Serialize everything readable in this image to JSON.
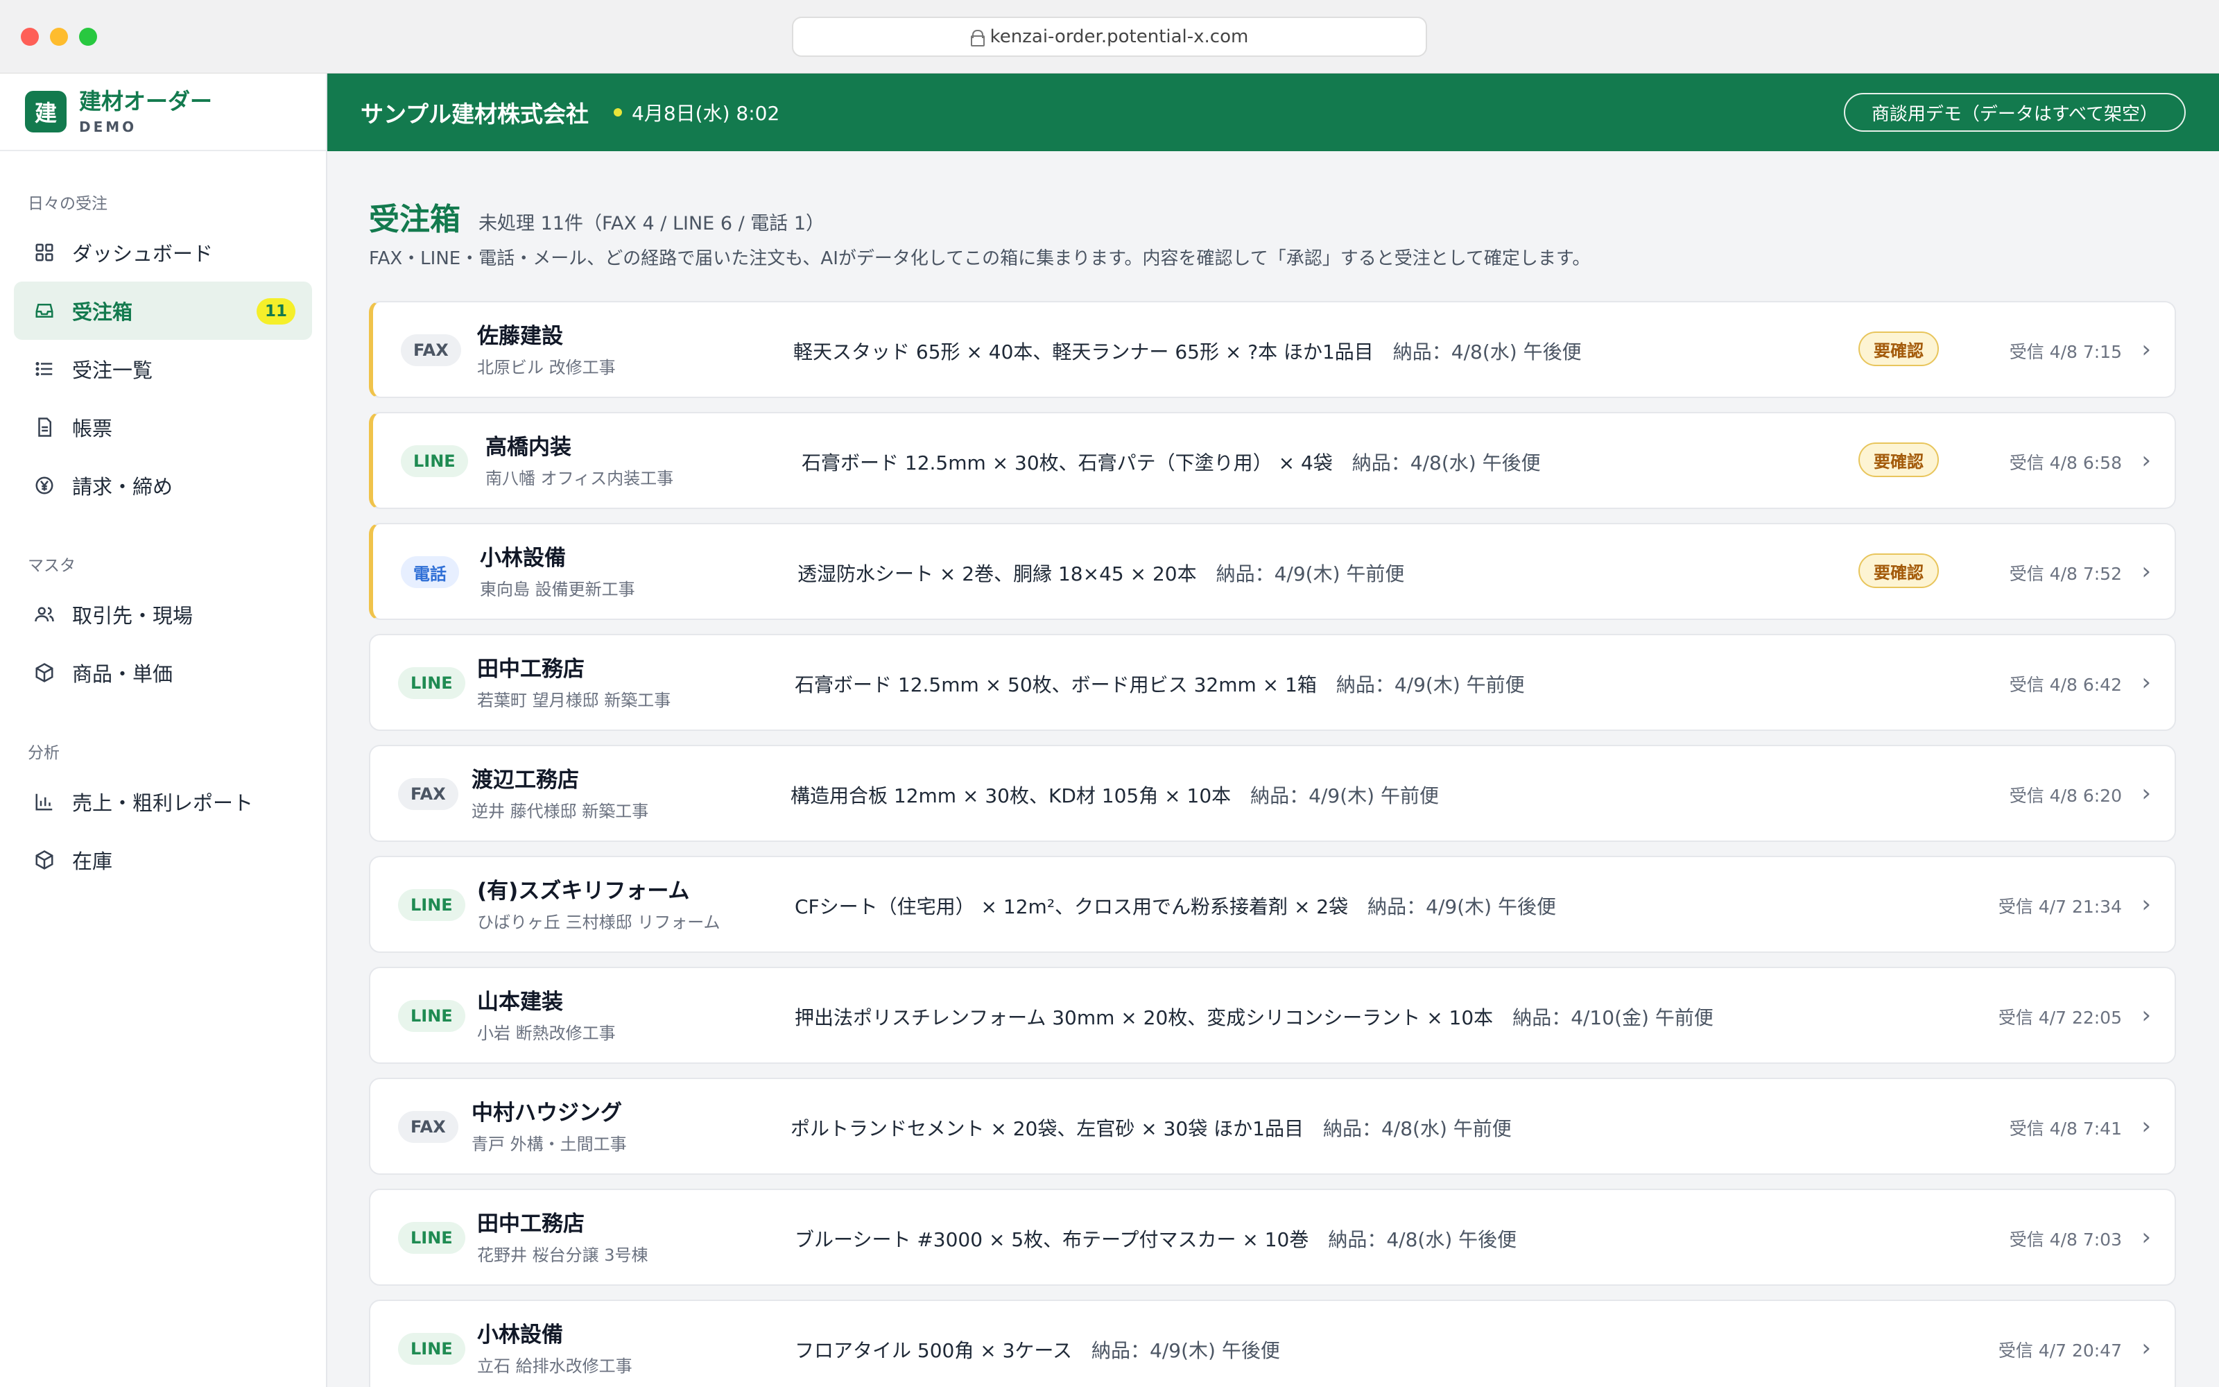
{
  "browser": {
    "url": "kenzai-order.potential-x.com"
  },
  "brand": {
    "logo_char": "建",
    "name": "建材オーダー",
    "sub": "DEMO"
  },
  "sidebar": {
    "sections": [
      {
        "title": "日々の受注",
        "items": [
          {
            "label": "ダッシュボード",
            "icon": "grid-icon"
          },
          {
            "label": "受注箱",
            "icon": "inbox-icon",
            "badge": "11",
            "active": true
          },
          {
            "label": "受注一覧",
            "icon": "list-icon"
          },
          {
            "label": "帳票",
            "icon": "document-icon"
          },
          {
            "label": "請求・締め",
            "icon": "yen-icon"
          }
        ]
      },
      {
        "title": "マスタ",
        "items": [
          {
            "label": "取引先・現場",
            "icon": "users-icon"
          },
          {
            "label": "商品・単価",
            "icon": "box-icon"
          }
        ]
      },
      {
        "title": "分析",
        "items": [
          {
            "label": "売上・粗利レポート",
            "icon": "chart-icon"
          },
          {
            "label": "在庫",
            "icon": "box-icon"
          }
        ]
      }
    ]
  },
  "header": {
    "company": "サンプル建材株式会社",
    "datetime": "4月8日(水) 8:02",
    "demo_label": "商談用デモ（データはすべて架空）"
  },
  "main": {
    "title": "受注箱",
    "summary": "未処理 11件（FAX 4 / LINE 6 / 電話 1）",
    "description": "FAX・LINE・電話・メール、どの経路で届いた注文も、AIがデータ化してこの箱に集まります。内容を確認して「承認」すると受注として確定します。",
    "orders": [
      {
        "channel": "FAX",
        "channel_class": "FAX",
        "customer": "佐藤建設",
        "site": "北原ビル 改修工事",
        "items": "軽天スタッド 65形 × 40本、軽天ランナー 65形 × ?本 ほか1品目",
        "delivery": "納品：4/8(水) 午後便",
        "status": "要確認",
        "received": "受信 4/8 7:15"
      },
      {
        "channel": "LINE",
        "channel_class": "LINE",
        "customer": "高橋内装",
        "site": "南八幡 オフィス内装工事",
        "items": "石膏ボード 12.5mm × 30枚、石膏パテ（下塗り用） × 4袋",
        "delivery": "納品：4/8(水) 午後便",
        "status": "要確認",
        "received": "受信 4/8 6:58"
      },
      {
        "channel": "電話",
        "channel_class": "TEL",
        "customer": "小林設備",
        "site": "東向島 設備更新工事",
        "items": "透湿防水シート × 2巻、胴縁 18×45 × 20本",
        "delivery": "納品：4/9(木) 午前便",
        "status": "要確認",
        "received": "受信 4/8 7:52"
      },
      {
        "channel": "LINE",
        "channel_class": "LINE",
        "customer": "田中工務店",
        "site": "若葉町 望月様邸 新築工事",
        "items": "石膏ボード 12.5mm × 50枚、ボード用ビス 32mm × 1箱",
        "delivery": "納品：4/9(木) 午前便",
        "status": "",
        "received": "受信 4/8 6:42"
      },
      {
        "channel": "FAX",
        "channel_class": "FAX",
        "customer": "渡辺工務店",
        "site": "逆井 藤代様邸 新築工事",
        "items": "構造用合板 12mm × 30枚、KD材 105角 × 10本",
        "delivery": "納品：4/9(木) 午前便",
        "status": "",
        "received": "受信 4/8 6:20"
      },
      {
        "channel": "LINE",
        "channel_class": "LINE",
        "customer": "(有)スズキリフォーム",
        "site": "ひばりヶ丘 三村様邸 リフォーム",
        "items": "CFシート（住宅用） × 12m²、クロス用でん粉系接着剤 × 2袋",
        "delivery": "納品：4/9(木) 午後便",
        "status": "",
        "received": "受信 4/7 21:34"
      },
      {
        "channel": "LINE",
        "channel_class": "LINE",
        "customer": "山本建装",
        "site": "小岩 断熱改修工事",
        "items": "押出法ポリスチレンフォーム 30mm × 20枚、変成シリコンシーラント × 10本",
        "delivery": "納品：4/10(金) 午前便",
        "status": "",
        "received": "受信 4/7 22:05"
      },
      {
        "channel": "FAX",
        "channel_class": "FAX",
        "customer": "中村ハウジング",
        "site": "青戸 外構・土間工事",
        "items": "ポルトランドセメント × 20袋、左官砂 × 30袋 ほか1品目",
        "delivery": "納品：4/8(水) 午前便",
        "status": "",
        "received": "受信 4/8 7:41"
      },
      {
        "channel": "LINE",
        "channel_class": "LINE",
        "customer": "田中工務店",
        "site": "花野井 桜台分譲 3号棟",
        "items": "ブルーシート #3000 × 5枚、布テープ付マスカー × 10巻",
        "delivery": "納品：4/8(水) 午後便",
        "status": "",
        "received": "受信 4/8 7:03"
      },
      {
        "channel": "LINE",
        "channel_class": "LINE",
        "customer": "小林設備",
        "site": "立石 給排水改修工事",
        "items": "フロアタイル 500角 × 3ケース",
        "delivery": "納品：4/9(木) 午後便",
        "status": "",
        "received": "受信 4/7 20:47"
      }
    ]
  }
}
